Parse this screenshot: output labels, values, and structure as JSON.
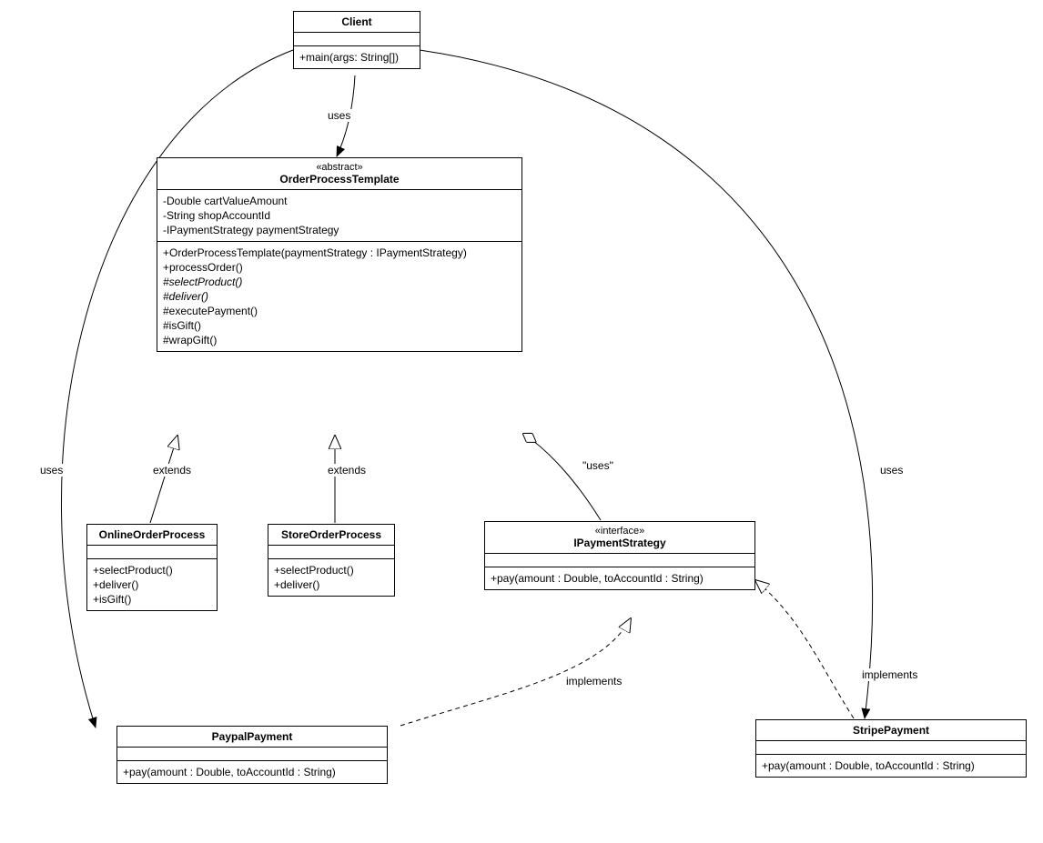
{
  "classes": {
    "client": {
      "name": "Client",
      "ops": [
        "+main(args: String[])"
      ]
    },
    "orderProcessTemplate": {
      "stereotype": "«abstract»",
      "name": "OrderProcessTemplate",
      "attrs": [
        "-Double cartValueAmount",
        "-String shopAccountId",
        "-IPaymentStrategy paymentStrategy"
      ],
      "ops": [
        {
          "text": "+OrderProcessTemplate(paymentStrategy : IPaymentStrategy)"
        },
        {
          "text": "+processOrder()"
        },
        {
          "text": "#selectProduct()",
          "italic": true
        },
        {
          "text": "#deliver()",
          "italic": true
        },
        {
          "text": "#executePayment()"
        },
        {
          "text": "#isGift()"
        },
        {
          "text": "#wrapGift()"
        }
      ]
    },
    "onlineOrderProcess": {
      "name": "OnlineOrderProcess",
      "ops": [
        "+selectProduct()",
        "+deliver()",
        "+isGift()"
      ]
    },
    "storeOrderProcess": {
      "name": "StoreOrderProcess",
      "ops": [
        "+selectProduct()",
        "+deliver()"
      ]
    },
    "iPaymentStrategy": {
      "stereotype": "«interface»",
      "name": "IPaymentStrategy",
      "ops": [
        "+pay(amount : Double, toAccountId : String)"
      ]
    },
    "paypalPayment": {
      "name": "PaypalPayment",
      "ops": [
        "+pay(amount : Double, toAccountId : String)"
      ]
    },
    "stripePayment": {
      "name": "StripePayment",
      "ops": [
        "+pay(amount : Double, toAccountId : String)"
      ]
    }
  },
  "labels": {
    "uses1": "uses",
    "extends1": "extends",
    "extends2": "extends",
    "usesQuoted": "\"uses\"",
    "usesLeft": "uses",
    "usesRight": "uses",
    "implements1": "implements",
    "implements2": "implements"
  }
}
